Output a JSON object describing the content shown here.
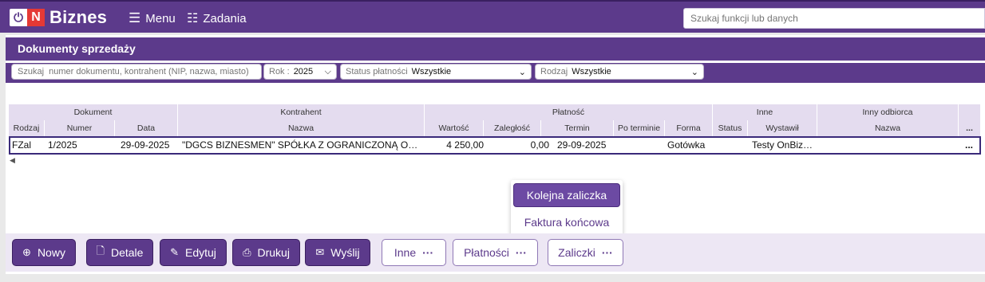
{
  "top": {
    "logo_n": "N",
    "logo_text": "Biznes",
    "menu_label": "Menu",
    "tasks_label": "Zadania",
    "search_placeholder": "Szukaj funkcji lub danych"
  },
  "panel": {
    "title": "Dokumenty sprzedaży"
  },
  "filters": {
    "search_placeholder": "Szukaj  numer dokumentu, kontrahent (NIP, nazwa, miasto)",
    "year_label": "Rok :",
    "year_value": "2025",
    "status_label": "Status płatności",
    "status_value": "Wszystkie",
    "type_label": "Rodzaj",
    "type_value": "Wszystkie"
  },
  "table": {
    "groups": [
      "Dokument",
      "Kontrahent",
      "Płatność",
      "Inne",
      "Inny odbiorca"
    ],
    "columns": [
      "Rodzaj",
      "Numer",
      "Data",
      "Nazwa",
      "Wartość",
      "Zaległość",
      "Termin",
      "Po terminie",
      "Forma",
      "Status",
      "Wystawił",
      "Nazwa",
      "..."
    ],
    "rows": [
      {
        "rodzaj": "FZal",
        "numer": "1/2025",
        "data": "29-09-2025",
        "nazwa": "\"DGCS BIZNESMEN\" SPÓŁKA Z OGRANICZONĄ ODPOWIEDZIALNOŚCIĄ",
        "wartosc": "4 250,00",
        "zaleglosc": "0,00",
        "termin": "29-09-2025",
        "po_terminie": "",
        "forma": "Gotówka",
        "status": "",
        "wystawil": "Testy OnBiznes",
        "inny_nazwa": "",
        "more": "..."
      }
    ]
  },
  "popup": {
    "items": [
      "Kolejna zaliczka",
      "Faktura końcowa"
    ]
  },
  "buttons": {
    "new": "Nowy",
    "details": "Detale",
    "edit": "Edytuj",
    "print": "Drukuj",
    "send": "Wyślij",
    "other": "Inne",
    "payments": "Płatności",
    "advances": "Zaliczki"
  },
  "colors": {
    "brand": "#5c3a8b",
    "header_bg": "#e4dcef",
    "logo_red": "#e53935"
  }
}
